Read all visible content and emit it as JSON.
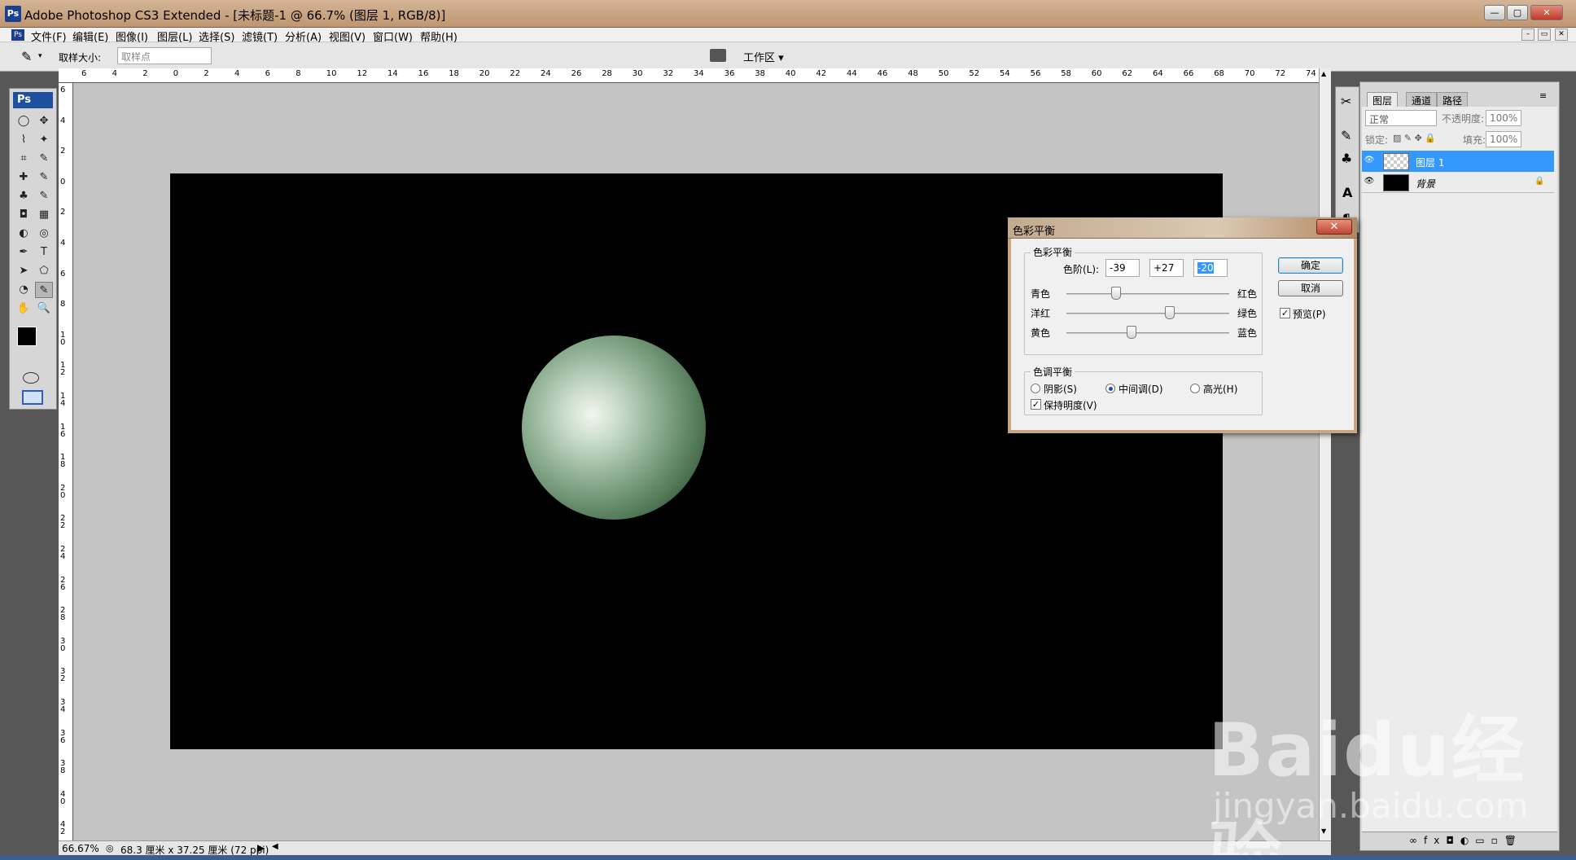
{
  "window": {
    "title": "Adobe Photoshop CS3 Extended - [未标题-1 @ 66.7% (图层 1, RGB/8)]",
    "logo": "Ps",
    "min": "—",
    "max": "▢",
    "close": "✕"
  },
  "menu": [
    "文件(F)",
    "编辑(E)",
    "图像(I)",
    "图层(L)",
    "选择(S)",
    "滤镜(T)",
    "分析(A)",
    "视图(V)",
    "窗口(W)",
    "帮助(H)"
  ],
  "options": {
    "sample_label": "取样大小:",
    "sample_value": "取样点",
    "workspace": "工作区 ▾"
  },
  "toolbox": {
    "logo": "Ps",
    "tools": [
      "◯",
      "✥",
      "⌇",
      "✦",
      "⌗",
      "✎",
      "✚",
      "✎",
      "♣",
      "✎",
      "◘",
      "▦",
      "◐",
      "◎",
      "✒",
      "T",
      "➤",
      "⬠",
      "◔",
      "✎",
      "✋",
      "🔍"
    ]
  },
  "rulers": {
    "h": [
      "6",
      "4",
      "2",
      "0",
      "2",
      "4",
      "6",
      "8",
      "10",
      "12",
      "14",
      "16",
      "18",
      "20",
      "22",
      "24",
      "26",
      "28",
      "30",
      "32",
      "34",
      "36",
      "38",
      "40",
      "42",
      "44",
      "46",
      "48",
      "50",
      "52",
      "54",
      "56",
      "58",
      "60",
      "62",
      "64",
      "66",
      "68",
      "70",
      "72",
      "74"
    ],
    "v": [
      "6",
      "4",
      "2",
      "0",
      "2",
      "4",
      "6",
      "8",
      "10",
      "12",
      "14",
      "16",
      "18",
      "20",
      "22",
      "24",
      "26",
      "28",
      "30",
      "32",
      "34",
      "36",
      "38",
      "40",
      "42"
    ]
  },
  "status": {
    "zoom": "66.67%",
    "doc": "68.3 厘米 x 37.25 厘米 (72 ppi)"
  },
  "layers_panel": {
    "tabs": [
      "图层",
      "通道",
      "路径"
    ],
    "blend": "正常",
    "opacity_label": "不透明度:",
    "opacity": "100%",
    "lock_label": "锁定:",
    "fill_label": "填充:",
    "fill": "100%",
    "layers": [
      {
        "name": "图层 1",
        "selected": true
      },
      {
        "name": "背景",
        "selected": false
      }
    ]
  },
  "dialog": {
    "title": "色彩平衡",
    "group1": "色彩平衡",
    "levels_label": "色阶(L):",
    "levels": [
      "-39",
      "+27",
      "-20"
    ],
    "sliders": [
      {
        "left": "青色",
        "right": "红色",
        "value": -39
      },
      {
        "left": "洋红",
        "right": "绿色",
        "value": 27
      },
      {
        "left": "黄色",
        "right": "蓝色",
        "value": -20
      }
    ],
    "group2": "色调平衡",
    "tones": [
      "阴影(S)",
      "中间调(D)",
      "高光(H)"
    ],
    "tone_selected": "中间调(D)",
    "preserve": "保持明度(V)",
    "ok": "确定",
    "cancel": "取消",
    "preview": "预览(P)"
  },
  "watermark": {
    "brand": "Baidu经验",
    "url": "jingyan.baidu.com"
  }
}
